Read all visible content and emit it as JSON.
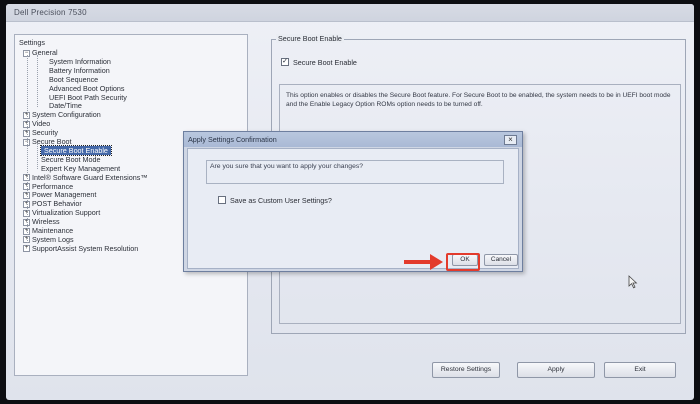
{
  "window": {
    "title": "Dell Precision 7530"
  },
  "tree": {
    "title": "Settings",
    "items": [
      {
        "label": "General",
        "expander": "−",
        "level": 1
      },
      {
        "label": "System Information",
        "level": 3
      },
      {
        "label": "Battery Information",
        "level": 3
      },
      {
        "label": "Boot Sequence",
        "level": 3
      },
      {
        "label": "Advanced Boot Options",
        "level": 3
      },
      {
        "label": "UEFI Boot Path Security",
        "level": 3
      },
      {
        "label": "Date/Time",
        "level": 3
      },
      {
        "label": "System Configuration",
        "expander": "+",
        "level": 1
      },
      {
        "label": "Video",
        "expander": "+",
        "level": 1
      },
      {
        "label": "Security",
        "expander": "+",
        "level": 1
      },
      {
        "label": "Secure Boot",
        "expander": "−",
        "level": 1
      },
      {
        "label": "Secure Boot Enable",
        "level": 2,
        "selected": true
      },
      {
        "label": "Secure Boot Mode",
        "level": 2
      },
      {
        "label": "Expert Key Management",
        "level": 2
      },
      {
        "label": "Intel® Software Guard Extensions™",
        "expander": "+",
        "level": 1
      },
      {
        "label": "Performance",
        "expander": "+",
        "level": 1
      },
      {
        "label": "Power Management",
        "expander": "+",
        "level": 1
      },
      {
        "label": "POST Behavior",
        "expander": "+",
        "level": 1
      },
      {
        "label": "Virtualization Support",
        "expander": "+",
        "level": 1
      },
      {
        "label": "Wireless",
        "expander": "+",
        "level": 1
      },
      {
        "label": "Maintenance",
        "expander": "+",
        "level": 1
      },
      {
        "label": "System Logs",
        "expander": "+",
        "level": 1
      },
      {
        "label": "SupportAssist System Resolution",
        "expander": "+",
        "level": 1
      }
    ]
  },
  "content": {
    "group_title": "Secure Boot Enable",
    "checkbox_label": "Secure Boot Enable",
    "checkbox_checked": true,
    "description": "This option enables or disables the Secure Boot feature. For Secure Boot to be enabled, the system needs to be in UEFI boot mode and the Enable Legacy Option ROMs option needs to be turned off."
  },
  "dialog": {
    "title": "Apply Settings Confirmation",
    "close_glyph": "×",
    "question": "Are you sure that you want to apply your changes?",
    "save_custom_label": "Save as Custom User Settings?",
    "ok_label": "OK",
    "cancel_label": "Cancel"
  },
  "buttons": {
    "restore": "Restore Settings",
    "apply": "Apply",
    "exit": "Exit"
  },
  "annotation": {
    "color": "#e33b2c"
  }
}
